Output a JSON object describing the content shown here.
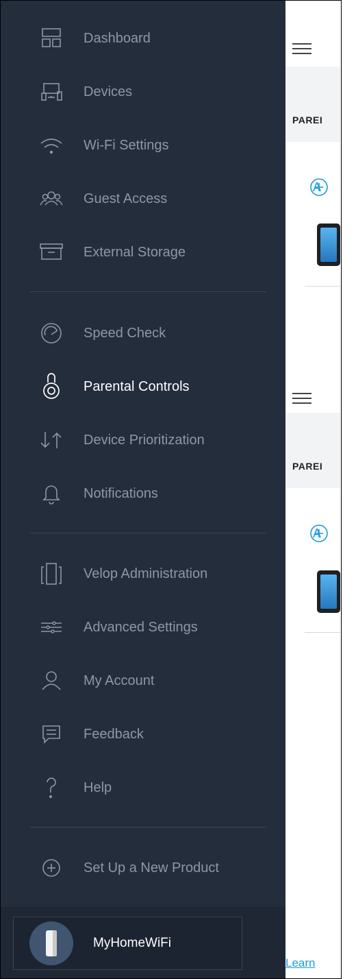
{
  "sidebar": {
    "items": [
      {
        "label": "Dashboard",
        "icon": "dashboard-icon"
      },
      {
        "label": "Devices",
        "icon": "devices-icon"
      },
      {
        "label": "Wi-Fi Settings",
        "icon": "wifi-icon"
      },
      {
        "label": "Guest Access",
        "icon": "guest-access-icon"
      },
      {
        "label": "External Storage",
        "icon": "storage-icon"
      },
      {
        "label": "Speed Check",
        "icon": "speedometer-icon"
      },
      {
        "label": "Parental Controls",
        "icon": "lock-icon",
        "active": true
      },
      {
        "label": "Device Prioritization",
        "icon": "priority-arrows-icon"
      },
      {
        "label": "Notifications",
        "icon": "bell-icon"
      },
      {
        "label": "Velop Administration",
        "icon": "velop-node-icon"
      },
      {
        "label": "Advanced Settings",
        "icon": "sliders-icon"
      },
      {
        "label": "My Account",
        "icon": "user-icon"
      },
      {
        "label": "Feedback",
        "icon": "feedback-icon"
      },
      {
        "label": "Help",
        "icon": "help-icon"
      },
      {
        "label": "Set Up a New Product",
        "icon": "plus-circle-icon"
      }
    ],
    "network_name": "MyHomeWiFi"
  },
  "content": {
    "section_label_truncated": "PAREI",
    "add_truncated": "A",
    "learn_link_truncated": "Learn"
  },
  "colors": {
    "sidebar_bg": "#242d3c",
    "inactive_text": "#8e97a4",
    "active_text": "#ffffff",
    "accent": "#1a9bd8"
  }
}
